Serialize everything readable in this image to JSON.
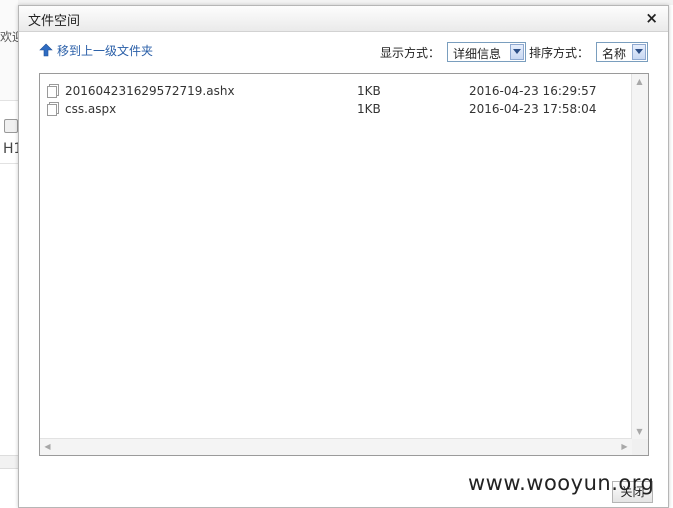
{
  "background": {
    "partial_text_1": "欢迎",
    "partial_text_2": "H1"
  },
  "dialog": {
    "title": "文件空间",
    "close_icon_glyph": "×",
    "toolbar": {
      "up_folder_label": "移到上一级文件夹",
      "view_mode_label": "显示方式：",
      "view_mode_value": "详细信息",
      "sort_label": "排序方式：",
      "sort_value": "名称"
    },
    "files": [
      {
        "name": "201604231629572719.ashx",
        "size": "1KB",
        "modified": "2016-04-23 16:29:57",
        "icon": "file-icon"
      },
      {
        "name": "css.aspx",
        "size": "1KB",
        "modified": "2016-04-23 17:58:04",
        "icon": "file-icon"
      }
    ],
    "close_button_label": "关闭"
  },
  "watermark": "www.wooyun.org",
  "colors": {
    "link": "#2a5fa8",
    "select_border": "#7a9ebe",
    "panel_border": "#9a9a9a"
  }
}
